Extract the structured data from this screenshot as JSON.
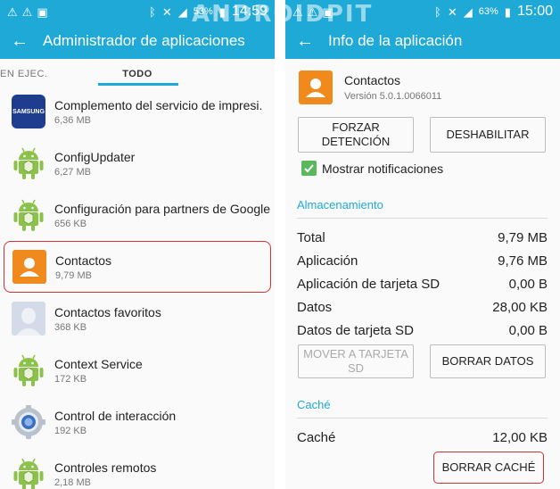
{
  "watermark": "ANDROIDPIT",
  "left": {
    "status": {
      "battery": "53%",
      "time": "14:59"
    },
    "title": "Administrador de aplicaciones",
    "tabs": [
      "EN EJEC.",
      "TODO"
    ],
    "apps": [
      {
        "name": "Complemento del servicio de impresi.",
        "size": "6,36 MB",
        "icon": "samsung-icon",
        "icon_text": "SAMSUNG"
      },
      {
        "name": "ConfigUpdater",
        "size": "6,27 MB",
        "icon": "android-icon"
      },
      {
        "name": "Configuración para partners de Google",
        "size": "656 KB",
        "icon": "android-icon"
      },
      {
        "name": "Contactos",
        "size": "9,79 MB",
        "icon": "contacts-icon"
      },
      {
        "name": "Contactos favoritos",
        "size": "368 KB",
        "icon": "favorite-contacts-icon"
      },
      {
        "name": "Context Service",
        "size": "172 KB",
        "icon": "android-icon"
      },
      {
        "name": "Control de interacción",
        "size": "192 KB",
        "icon": "gear-icon"
      },
      {
        "name": "Controles remotos",
        "size": "2,18 MB",
        "icon": "android-icon"
      }
    ]
  },
  "right": {
    "status": {
      "battery": "63%",
      "time": "15:00"
    },
    "title": "Info de la aplicación",
    "app_name": "Contactos",
    "app_version": "Versión 5.0.1.0066011",
    "force_stop": "FORZAR DETENCIÓN",
    "disable": "DESHABILITAR",
    "notifications": "Mostrar notificaciones",
    "storage_title": "Almacenamiento",
    "storage": [
      {
        "label": "Total",
        "value": "9,79 MB"
      },
      {
        "label": "Aplicación",
        "value": "9,76 MB"
      },
      {
        "label": "Aplicación de tarjeta SD",
        "value": "0,00 B"
      },
      {
        "label": "Datos",
        "value": "28,00 KB"
      },
      {
        "label": "Datos de tarjeta SD",
        "value": "0,00 B"
      }
    ],
    "move_sd": "MOVER A TARJETA SD",
    "clear_data": "BORRAR DATOS",
    "cache_title": "Caché",
    "cache_label": "Caché",
    "cache_value": "12,00 KB",
    "clear_cache": "BORRAR CACHÉ"
  },
  "colors": {
    "accent": "#1fa9d6",
    "highlight": "#cc3333",
    "contacts": "#f08a1c",
    "android": "#8bc34a"
  }
}
